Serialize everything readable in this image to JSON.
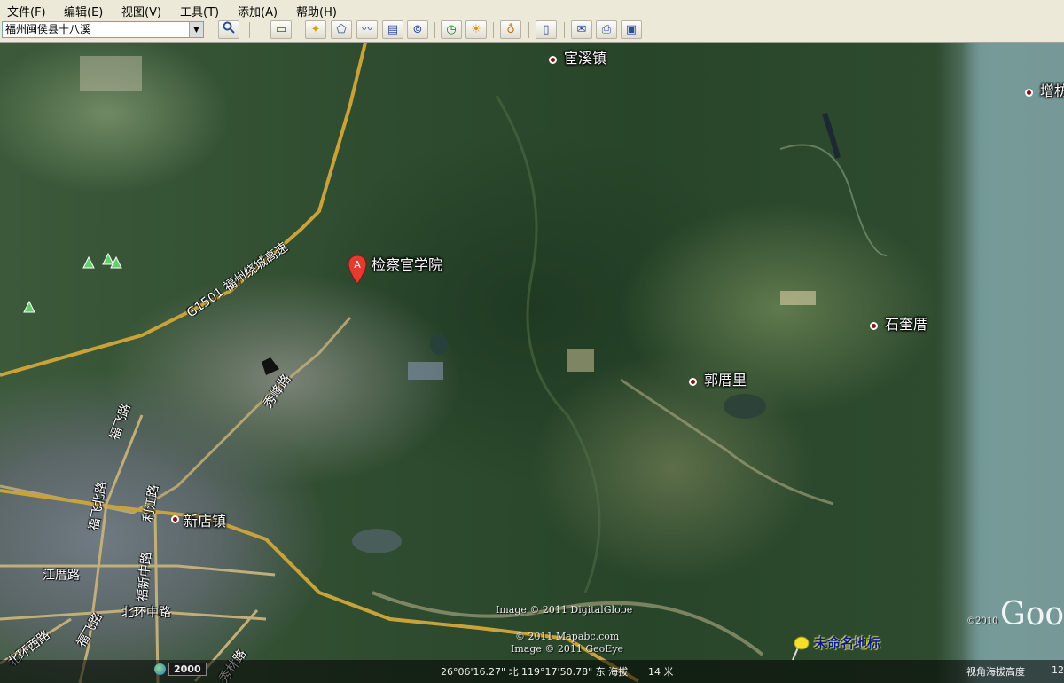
{
  "menu": [
    "文件(F)",
    "编辑(E)",
    "视图(V)",
    "工具(T)",
    "添加(A)",
    "帮助(H)"
  ],
  "search": {
    "value": "福州闽侯县十八溪"
  },
  "places": {
    "gongxi": "宦溪镇",
    "zengban": "增枋",
    "jianchaguan": "检察官学院",
    "shikui": "石奎厝",
    "guocuo": "郭厝里",
    "xindian": "新店镇"
  },
  "marker_letter": "A",
  "roads": {
    "g1501": "G1501 福州绕城高速",
    "xiufeng": "秀峰路",
    "fufei": "福飞路",
    "fufeibei": "福飞北路",
    "jiangcuo": "江厝路",
    "beihuanzhong": "北环中路",
    "beihuanxi": "北环西路",
    "fufei2": "福飞路",
    "xiulin": "秀林路",
    "lijiang": "利江路",
    "hengyu": "福新中路"
  },
  "credits": {
    "digitalglobe": "Image © 2011 DigitalGlobe",
    "mapabc": "© 2011 Mapabc.com",
    "geoeye": "Image © 2011 GeoEye",
    "copyright2010": "©2010"
  },
  "placemark_label": "未命名地标",
  "status": {
    "year": "2000",
    "coordinates": "26°06'16.27\" 北 119°17'50.78\" 东 海拔",
    "elevation": "14 米",
    "eye_alt_label": "视角海拔高度",
    "eye_alt_value": "12"
  },
  "logo": "Goo"
}
